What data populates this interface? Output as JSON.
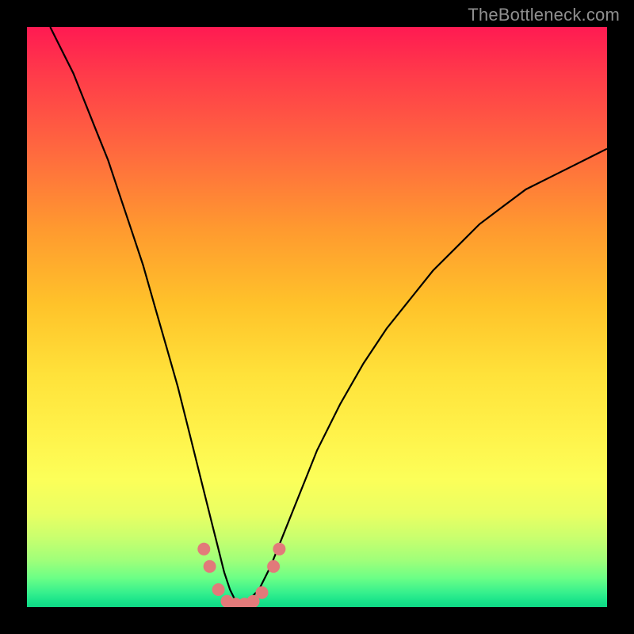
{
  "watermark": "TheBottleneck.com",
  "chart_data": {
    "type": "line",
    "title": "",
    "xlabel": "",
    "ylabel": "",
    "xlim": [
      0,
      100
    ],
    "ylim": [
      0,
      100
    ],
    "series": [
      {
        "name": "bottleneck-curve",
        "x": [
          4,
          6,
          8,
          10,
          12,
          14,
          16,
          18,
          20,
          22,
          24,
          26,
          28,
          30,
          32,
          33,
          34,
          35,
          36,
          37,
          38,
          40,
          42,
          44,
          46,
          48,
          50,
          54,
          58,
          62,
          66,
          70,
          74,
          78,
          82,
          86,
          90,
          94,
          98,
          100
        ],
        "y": [
          100,
          96,
          92,
          87,
          82,
          77,
          71,
          65,
          59,
          52,
          45,
          38,
          30,
          22,
          14,
          10,
          6,
          3,
          1,
          0,
          1,
          3,
          7,
          12,
          17,
          22,
          27,
          35,
          42,
          48,
          53,
          58,
          62,
          66,
          69,
          72,
          74,
          76,
          78,
          79
        ]
      }
    ],
    "markers": {
      "name": "highlight-dots",
      "color": "#e27a7a",
      "points": [
        {
          "x": 30.5,
          "y": 10
        },
        {
          "x": 31.5,
          "y": 7
        },
        {
          "x": 33.0,
          "y": 3
        },
        {
          "x": 34.5,
          "y": 1
        },
        {
          "x": 36.0,
          "y": 0.5
        },
        {
          "x": 37.5,
          "y": 0.5
        },
        {
          "x": 39.0,
          "y": 1
        },
        {
          "x": 40.5,
          "y": 2.5
        },
        {
          "x": 42.5,
          "y": 7
        },
        {
          "x": 43.5,
          "y": 10
        }
      ]
    },
    "background_gradient": {
      "top": "#ff1a52",
      "mid": "#fff24a",
      "bottom": "#0fd885"
    }
  }
}
